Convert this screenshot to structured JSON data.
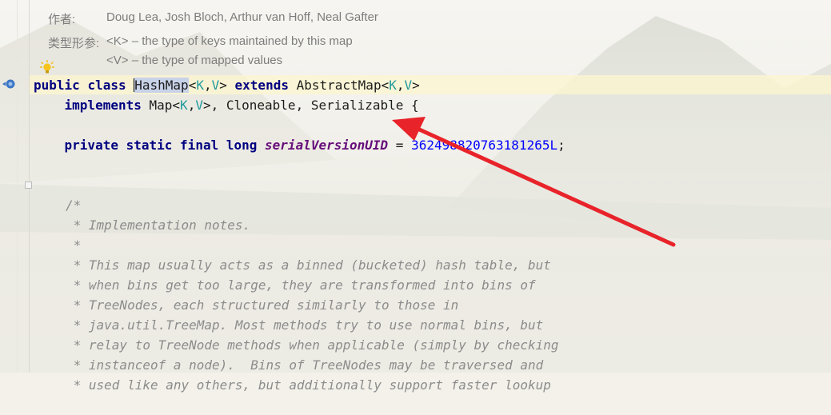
{
  "javadoc": {
    "author_label": "作者:",
    "author_value": "Doug Lea, Josh Bloch, Arthur van Hoff, Neal Gafter",
    "typeparams_label": "类型形参:",
    "typeparam_k": "<K> – the type of keys maintained by this map",
    "typeparam_v": "<V> – the type of mapped values"
  },
  "code": {
    "line1": {
      "kw_public": "public",
      "kw_class": "class",
      "class_name": "HashMap",
      "lt1": "<",
      "gen_k": "K",
      "comma1": ",",
      "gen_v": "V",
      "gt1": ">",
      "kw_extends": "extends",
      "super_name": "AbstractMap",
      "lt2": "<",
      "gen_k2": "K",
      "comma2": ",",
      "gen_v2": "V",
      "gt2": ">"
    },
    "line2": {
      "kw_implements": "implements",
      "map": "Map",
      "lt": "<",
      "gen_k": "K",
      "comma": ",",
      "gen_v": "V",
      "gt_rest": ">, Cloneable, Serializable {"
    },
    "line4": {
      "kw_private": "private",
      "kw_static": "static",
      "kw_final": "final",
      "kw_long": "long",
      "field": "serialVersionUID",
      "eq": "=",
      "number": "362498820763181265L",
      "semi": ";"
    },
    "comment_lines": [
      "/*",
      " * Implementation notes.",
      " *",
      " * This map usually acts as a binned (bucketed) hash table, but",
      " * when bins get too large, they are transformed into bins of",
      " * TreeNodes, each structured similarly to those in",
      " * java.util.TreeMap. Most methods try to use normal bins, but",
      " * relay to TreeNode methods when applicable (simply by checking",
      " * instanceof a node).  Bins of TreeNodes may be traversed and",
      " * used like any others, but additionally support faster lookup"
    ]
  },
  "annotation": {
    "arrow_color": "#e8232a"
  },
  "icons": {
    "bulb": "lightbulb-icon",
    "gutter": "implementation-gutter-icon",
    "fold": "fold-icon"
  }
}
